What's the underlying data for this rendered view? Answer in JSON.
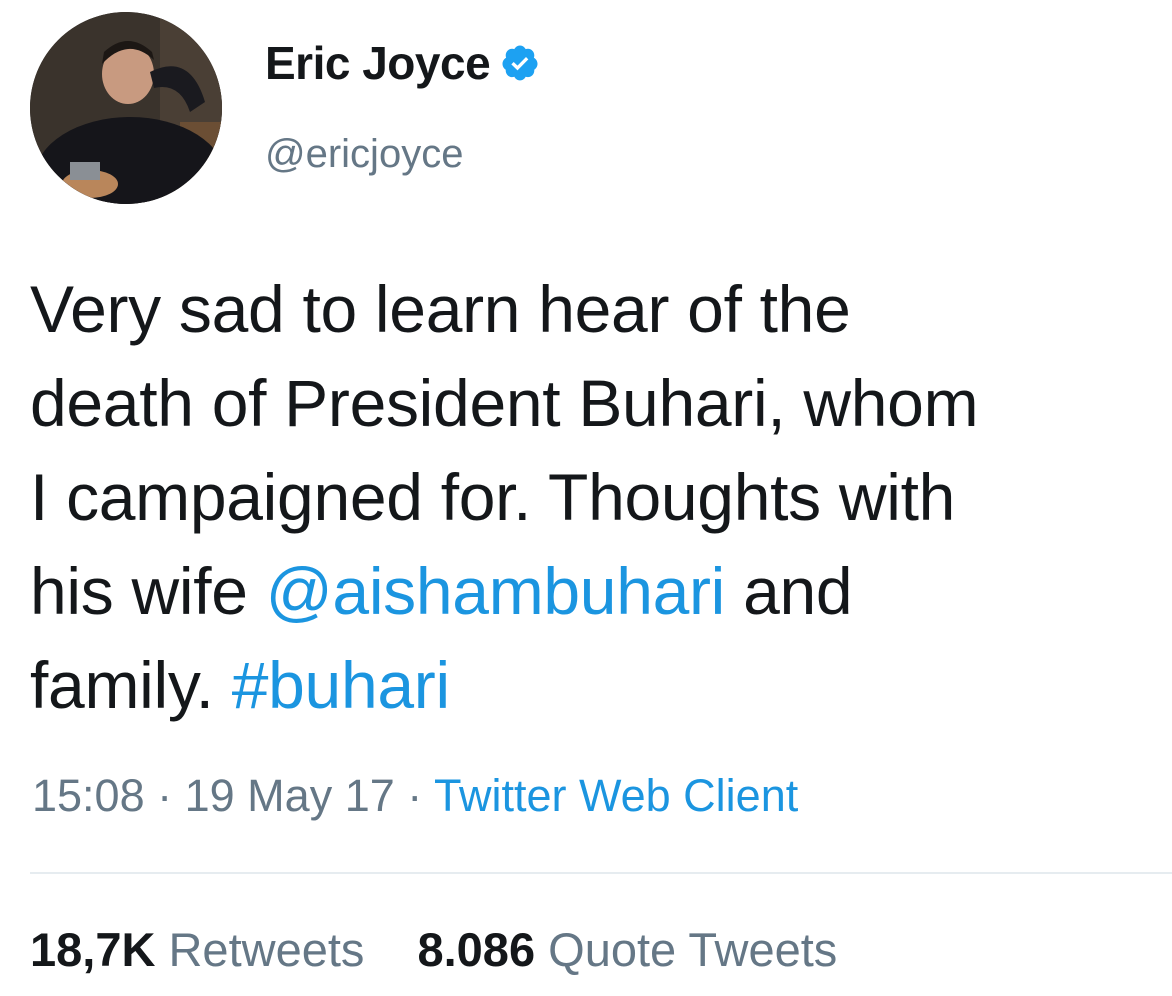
{
  "author": {
    "display_name": "Eric Joyce",
    "handle": "@ericjoyce",
    "verified": true
  },
  "tweet": {
    "line1": "Very sad to learn hear of the",
    "line2": "death of President Buhari, whom",
    "line3": "I campaigned for. Thoughts with",
    "line4_pre": "his wife ",
    "mention": "@aishambuhari",
    "line4_post": " and",
    "line5_pre": "family. ",
    "hashtag": "#buhari"
  },
  "meta": {
    "time": "15:08",
    "sep1": " · ",
    "date": "19 May 17",
    "sep2": " · ",
    "source": "Twitter Web Client"
  },
  "stats": {
    "retweets_count": "18,7K",
    "retweets_label": "Retweets",
    "quotes_count": "8.086",
    "quotes_label": "Quote Tweets"
  },
  "colors": {
    "link": "#1b95e0",
    "secondary_text": "#657786",
    "verified_badge": "#1da1f2"
  },
  "icons": {
    "verified": "verified-badge-icon"
  }
}
